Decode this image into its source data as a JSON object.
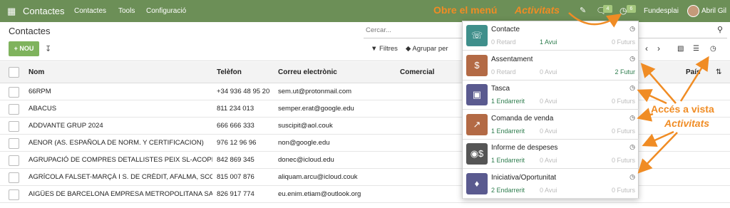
{
  "topbar": {
    "app_title": "Contactes",
    "menu": [
      "Contactes",
      "Tools",
      "Configuració"
    ],
    "chat_count": "4",
    "activity_count": "6",
    "company": "Fundesplai",
    "user": "Abril Gil"
  },
  "annotations": {
    "open_menu": "Obre el menú",
    "activities_top": "Activitats",
    "access_view_line1": "Accés a vista",
    "access_view_line2": "Activitats"
  },
  "control": {
    "breadcrumb": "Contactes",
    "new_button": "+ NOU",
    "search_placeholder": "Cercar...",
    "filters": "Filtres",
    "group_by": "Agrupar per"
  },
  "table": {
    "headers": {
      "name": "Nom",
      "phone": "Telèfon",
      "email": "Correu electrònic",
      "salesperson": "Comercial",
      "country": "País"
    },
    "rows": [
      {
        "name": "66RPM",
        "phone": "+34 936 48 95 20",
        "email": "sem.ut@protonmail.com"
      },
      {
        "name": "ABACUS",
        "phone": "811 234 013",
        "email": "semper.erat@google.edu"
      },
      {
        "name": "ADDVANTE GRUP 2024",
        "phone": "666 666 333",
        "email": "suscipit@aol.couk"
      },
      {
        "name": "AENOR (AS. ESPAÑOLA DE NORM. Y CERTIFICACION)",
        "phone": "976 12 96 96",
        "email": "non@google.edu"
      },
      {
        "name": "AGRUPACIÓ DE COMPRES DETALLISTES PEIX SL-ACOPEIX",
        "phone": "842 869 345",
        "email": "donec@icloud.edu"
      },
      {
        "name": "AGRÍCOLA FALSET-MARÇÀ I S. DE CRÈDIT, AFALMA, SCCL",
        "phone": "815 007 876",
        "email": "aliquam.arcu@icloud.couk"
      },
      {
        "name": "AIGÜES DE BARCELONA EMPRESA METROPOLITANA SA",
        "phone": "826 917 774",
        "email": "eu.enim.etiam@outlook.org"
      }
    ]
  },
  "activities": [
    {
      "name": "Contacte",
      "icon": "address-book-icon",
      "color": "#3f8f8b",
      "late": "0 Retard",
      "today": "1 Avui",
      "future": "0 Futurs",
      "late_hl": false,
      "today_hl": true,
      "future_hl": false
    },
    {
      "name": "Assentament",
      "icon": "invoice-icon",
      "color": "#b36a45",
      "late": "0 Retard",
      "today": "0 Avui",
      "future": "2 Futur",
      "late_hl": false,
      "today_hl": false,
      "future_hl": true
    },
    {
      "name": "Tasca",
      "icon": "puzzle-icon",
      "color": "#5a5a8f",
      "late": "1 Endarrerit",
      "today": "0 Avui",
      "future": "0 Futurs",
      "late_hl": true,
      "today_hl": false,
      "future_hl": false
    },
    {
      "name": "Comanda de venda",
      "icon": "chart-icon",
      "color": "#b36a45",
      "late": "1 Endarrerit",
      "today": "0 Avui",
      "future": "0 Futurs",
      "late_hl": true,
      "today_hl": false,
      "future_hl": false
    },
    {
      "name": "Informe de despeses",
      "icon": "expense-icon",
      "color": "#555555",
      "late": "1 Endarrerit",
      "today": "0 Avui",
      "future": "0 Futurs",
      "late_hl": true,
      "today_hl": false,
      "future_hl": false
    },
    {
      "name": "Iniciativa/Oportunitat",
      "icon": "handshake-icon",
      "color": "#5a5a8f",
      "late": "2 Endarrerit",
      "today": "0 Avui",
      "future": "0 Futurs",
      "late_hl": true,
      "today_hl": false,
      "future_hl": false
    }
  ]
}
